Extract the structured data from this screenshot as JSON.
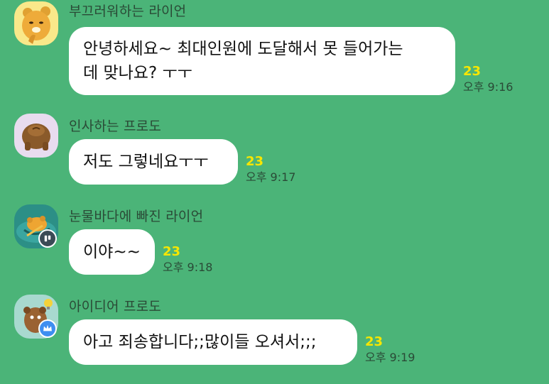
{
  "messages": [
    {
      "sender": "부끄러워하는 라이언",
      "lines": [
        "안녕하세요~ 최대인원에 도달해서 못 들어가는",
        "데 맞나요? ㅜㅜ"
      ],
      "unread": "23",
      "time": "오후 9:16",
      "avatar_icon": "ryan-shy-avatar-icon"
    },
    {
      "sender": "인사하는 프로도",
      "lines": [
        "저도 그렇네요ㅜㅜ"
      ],
      "unread": "23",
      "time": "오후 9:17",
      "avatar_icon": "frodo-bowing-avatar-icon"
    },
    {
      "sender": "눈물바다에 빠진 라이언",
      "lines": [
        "이야~~"
      ],
      "unread": "23",
      "time": "오후 9:18",
      "avatar_icon": "ryan-crying-avatar-icon",
      "badge_icon": "manager-badge-icon"
    },
    {
      "sender": "아이디어 프로도",
      "lines": [
        "아고 죄송합니다;;많이들 오셔서;;;"
      ],
      "unread": "23",
      "time": "오후 9:19",
      "avatar_icon": "frodo-idea-avatar-icon",
      "badge_icon": "host-crown-badge-icon"
    }
  ],
  "colors": {
    "background": "#4bb478",
    "bubble": "#ffffff",
    "unread": "#f7e600",
    "meta_text": "#2a4a36"
  }
}
